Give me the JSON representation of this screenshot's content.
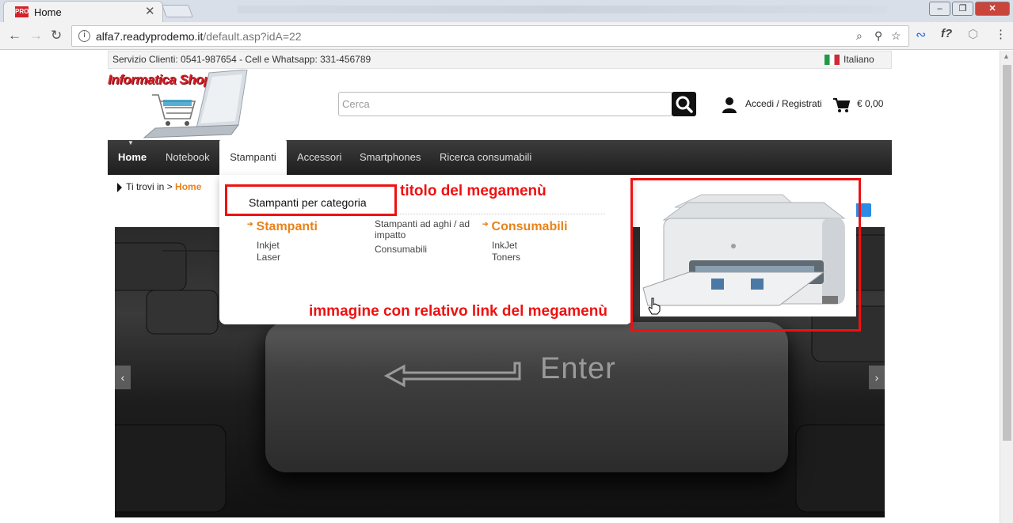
{
  "browser": {
    "tab_title": "Home",
    "tab_favicon": "PRO",
    "url_host": "alfa7.readyprodemo.it",
    "url_path": "/default.asp?idA=22",
    "window_controls": [
      "–",
      "❐",
      "✕"
    ]
  },
  "topbar": {
    "service_text": "Servizio Clienti: 0541-987654 - Cell e Whatsapp: 331-456789",
    "language": "Italiano"
  },
  "header": {
    "logo_text": "Informatica Shop",
    "search_placeholder": "Cerca",
    "login_label": "Accedi / Registrati",
    "cart_total": "€ 0,00"
  },
  "nav": {
    "items": [
      "Home",
      "Notebook",
      "Stampanti",
      "Accessori",
      "Smartphones",
      "Ricerca consumabili"
    ],
    "active": "Stampanti"
  },
  "breadcrumb": {
    "prefix": "Ti trovi in >",
    "current": "Home"
  },
  "megamenu": {
    "title": "Stampanti per categoria",
    "columns": [
      {
        "heading": "Stampanti",
        "items": [
          "Inkjet",
          "Laser"
        ]
      },
      {
        "heading": "",
        "items": [
          "Stampanti ad aghi / ad impatto",
          "Consumabili"
        ]
      },
      {
        "heading": "Consumabili",
        "items": [
          "InkJet",
          "Toners"
        ]
      }
    ]
  },
  "hero": {
    "key_text": "Enter",
    "prev_arrow": "‹",
    "next_arrow": "›"
  },
  "annotations": {
    "title_label": "titolo del megamenù",
    "image_label": "immagine con relativo link del megamenù"
  },
  "colors": {
    "accent": "#e8821b",
    "annotation": "#ee1111",
    "nav_bg": "#2a2a2a"
  }
}
